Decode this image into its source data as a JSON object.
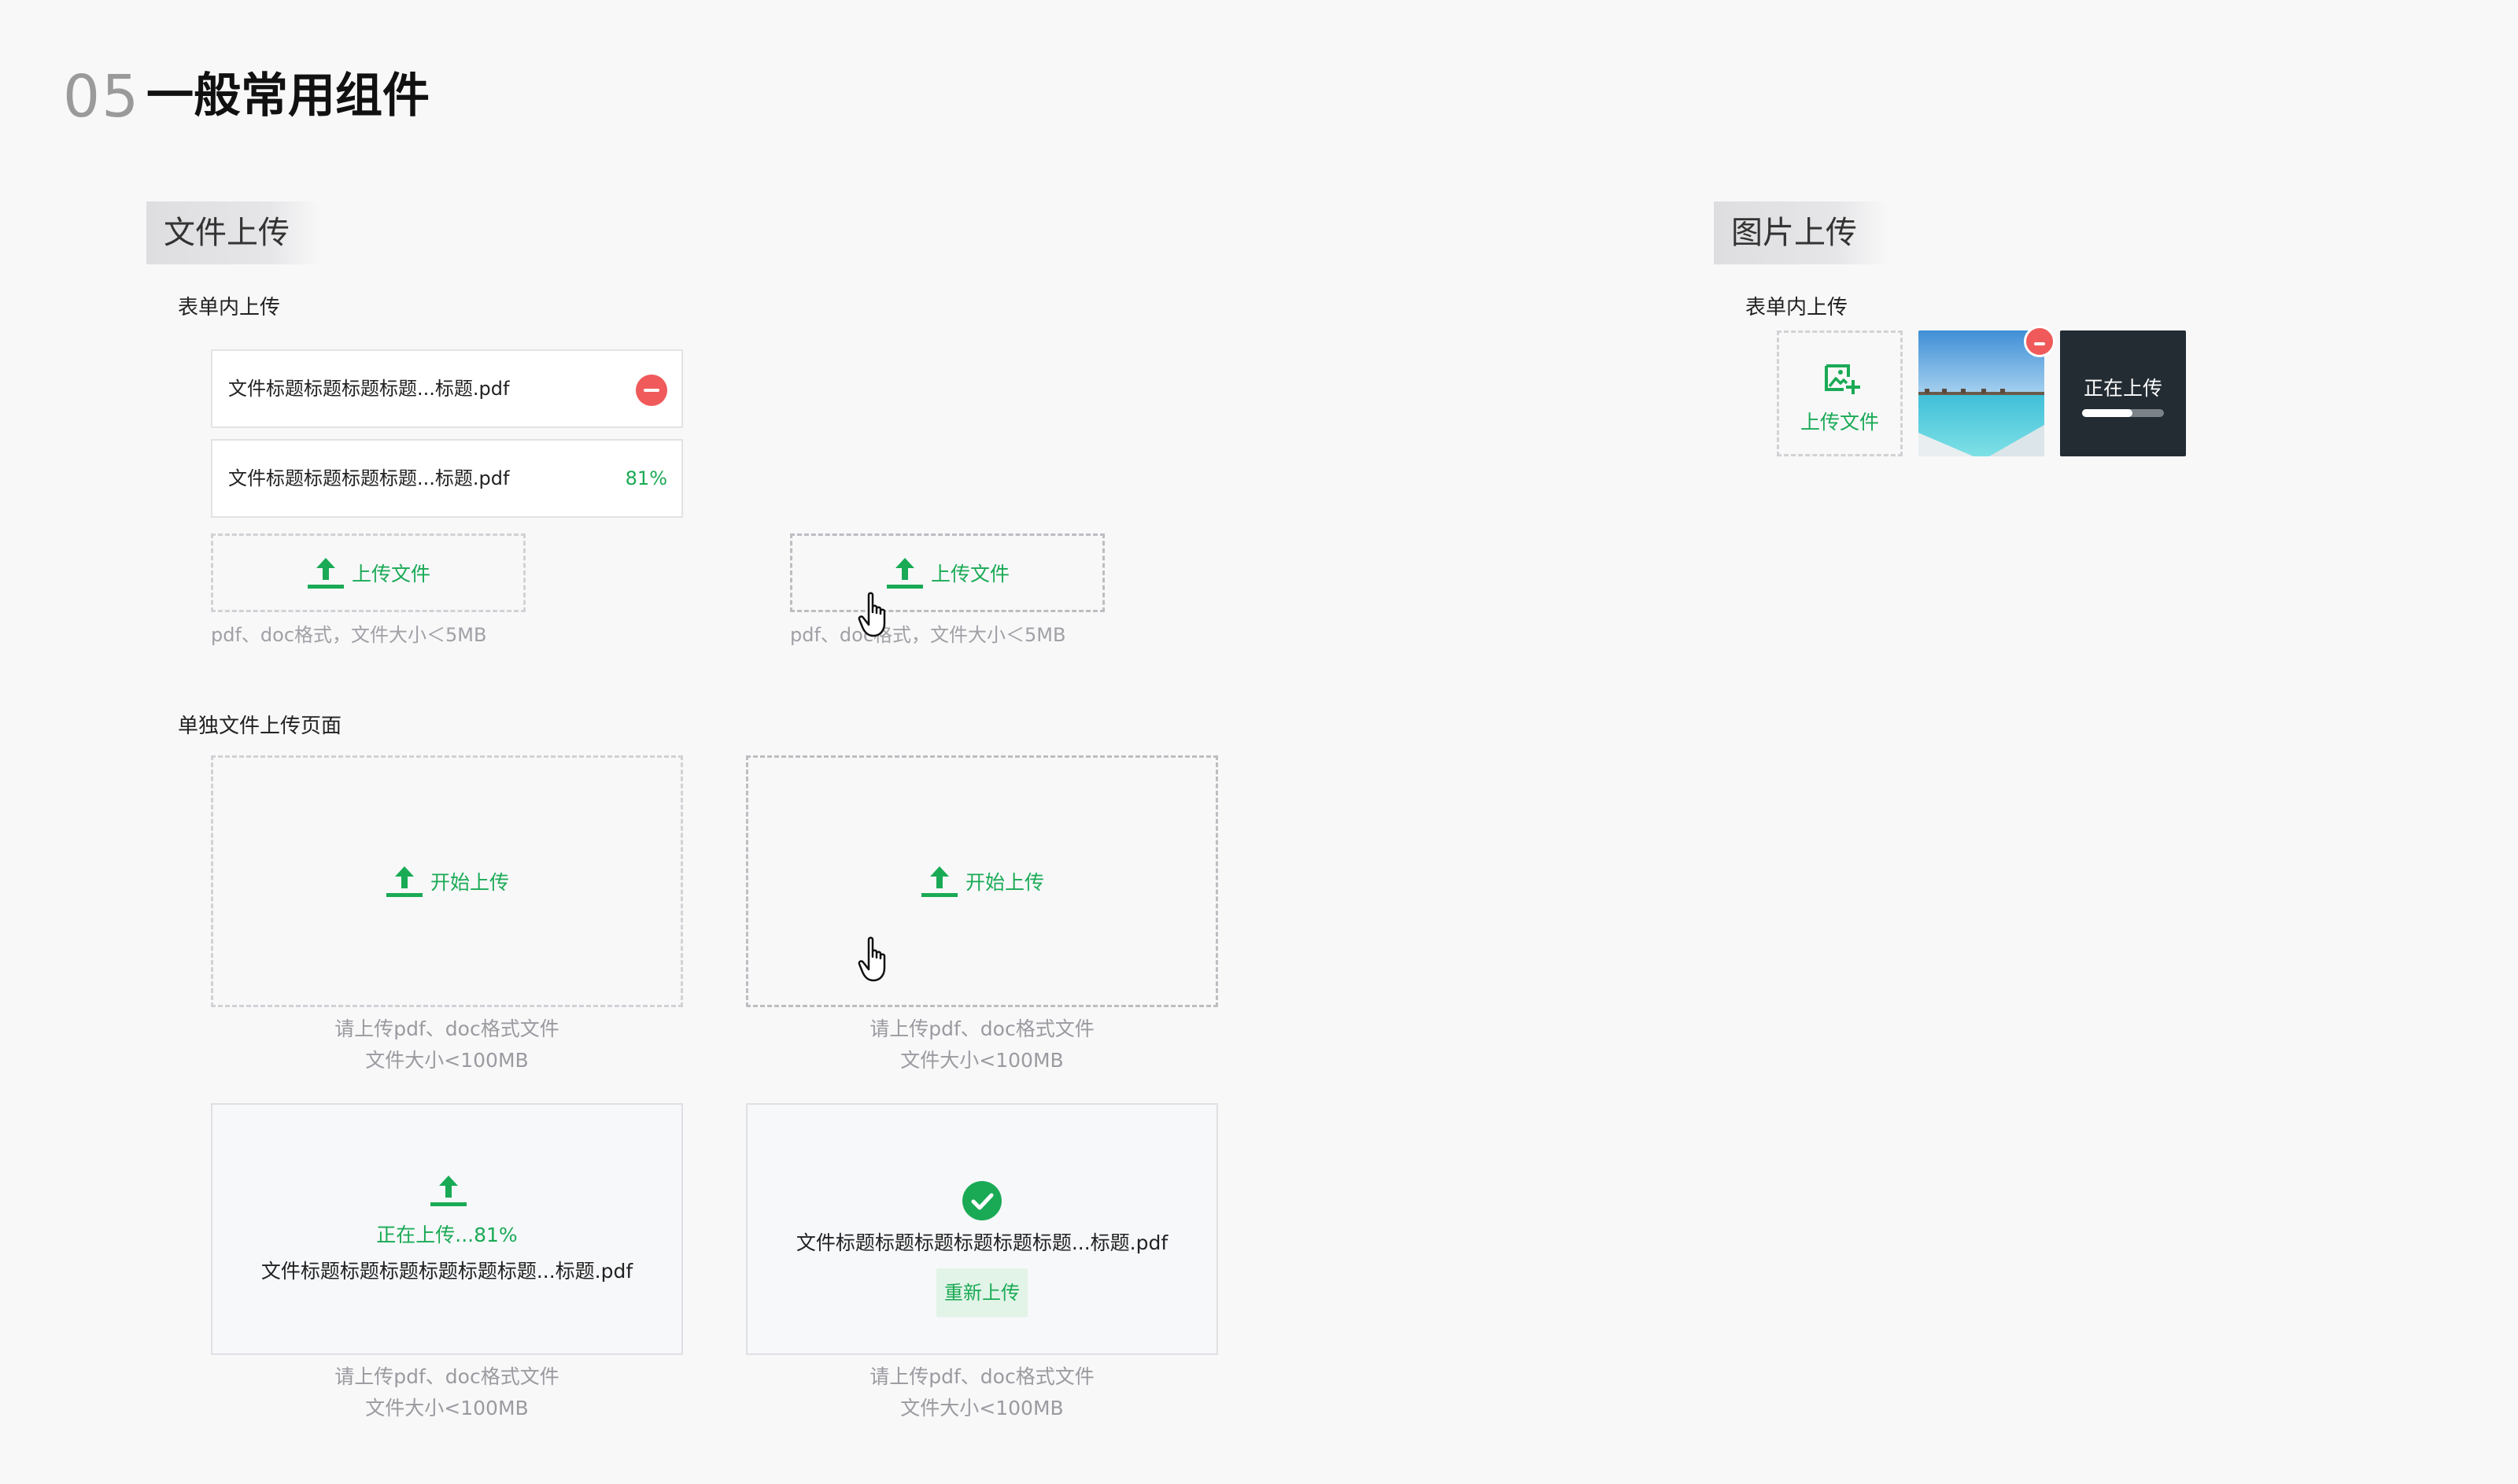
{
  "header": {
    "number": "05",
    "title": "一般常用组件"
  },
  "file_upload": {
    "section_title": "文件上传",
    "form_label": "表单内上传",
    "files": [
      {
        "name": "文件标题标题标题标题...标题.pdf",
        "status": "remove"
      },
      {
        "name": "文件标题标题标题标题...标题.pdf",
        "progress_text": "81%"
      }
    ],
    "upload_button": "上传文件",
    "upload_button_hover": "上传文件",
    "hint": "pdf、doc格式，文件大小＜5MB",
    "hint_hover": "pdf、doc格式，文件大小＜5MB",
    "page_label": "单独文件上传页面",
    "start_upload": "开始上传",
    "start_upload_hover": "开始上传",
    "page_hint_line1": "请上传pdf、doc格式文件",
    "page_hint_line2": "文件大小<100MB",
    "uploading_text": "正在上传...81%",
    "uploading_file": "文件标题标题标题标题标题标题...标题.pdf",
    "done_file": "文件标题标题标题标题标题标题...标题.pdf",
    "reupload": "重新上传"
  },
  "image_upload": {
    "section_title": "图片上传",
    "form_label": "表单内上传",
    "upload_button": "上传文件",
    "uploading_label": "正在上传",
    "uploading_progress": 0.62
  },
  "colors": {
    "accent": "#1aaa55",
    "danger": "#f05a5a",
    "dark_tile": "#232c33"
  },
  "icons": [
    "upload-arrow-icon",
    "remove-icon",
    "hand-cursor-icon",
    "check-circle-icon",
    "image-add-icon"
  ]
}
